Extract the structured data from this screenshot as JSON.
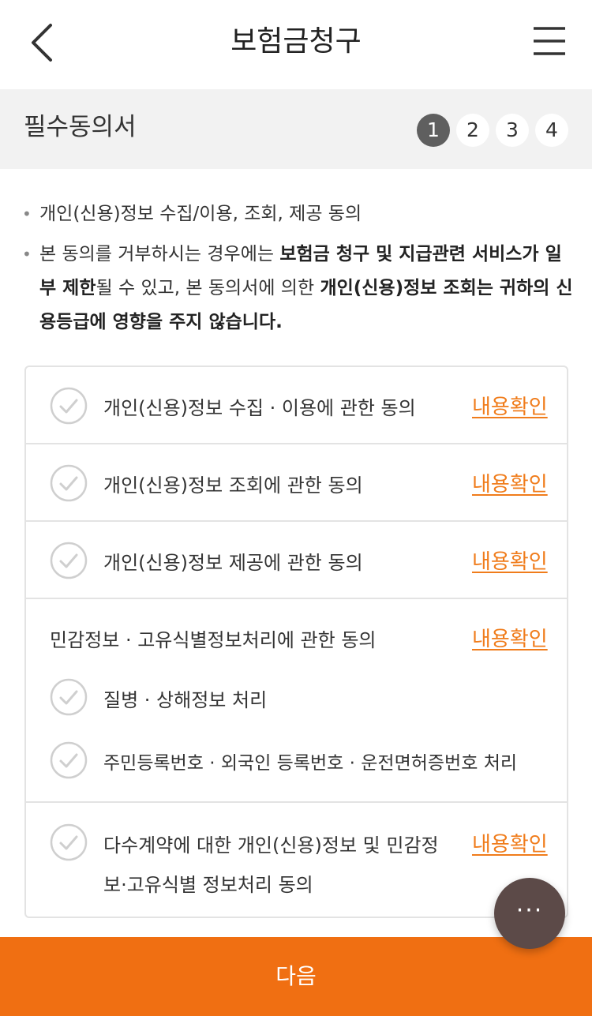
{
  "header": {
    "title": "보험금청구",
    "back_icon": "chevron-left-icon",
    "menu_icon": "hamburger-menu-icon"
  },
  "stepbar": {
    "title": "필수동의서",
    "steps": [
      "1",
      "2",
      "3",
      "4"
    ],
    "active_step": "1"
  },
  "notes": {
    "line1": "개인(신용)정보 수집/이용, 조회, 제공 동의",
    "line2_part1": "본 동의를 거부하시는 경우에는 ",
    "line2_bold1": "보험금 청구 및 지급관련 서비스가 일부 제한",
    "line2_part2": "될 수 있고, 본 동의서에 의한 ",
    "line2_bold2": "개인(신용)정보 조회는 귀하의 신용등급에 영향을 주지 않습니다."
  },
  "agreements": {
    "link_label": "내용확인",
    "collect": "개인(신용)정보 수집 · 이용에 관한 동의",
    "inquiry": "개인(신용)정보 조회에 관한 동의",
    "provide": "개인(신용)정보 제공에 관한 동의",
    "sensitive_title": "민감정보 · 고유식별정보처리에 관한 동의",
    "sensitive_sub1": "질병 · 상해정보 처리",
    "sensitive_sub2": "주민등록번호 · 외국인 등록번호 · 운전면허증번호 처리",
    "multi_line1": "다수계약에 대한 개인(신용)정보 및 민감정",
    "multi_line2": "보·고유식별 정보처리 동의"
  },
  "footer": {
    "next_label": "다음"
  },
  "fab": {
    "icon": "more-dots-icon",
    "label": "···"
  },
  "colors": {
    "accent": "#f06f12",
    "link": "#f07c1b",
    "active_step": "#5f5f5f",
    "stepbar_bg": "#f2f2f2",
    "fab_bg": "#5c4a48"
  }
}
